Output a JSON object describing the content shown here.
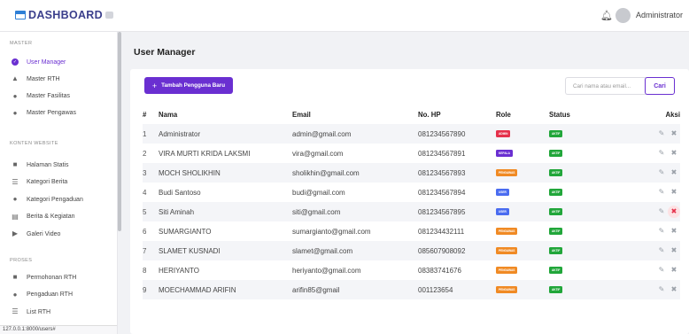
{
  "app": {
    "brand_prefix": "D",
    "brand": "DASHBOARD",
    "user": "Administrator"
  },
  "sidebar": {
    "sections": [
      {
        "label": "MASTER",
        "items": [
          {
            "label": "User Manager",
            "icon": "user-circle-icon",
            "active": true
          },
          {
            "label": "Master RTH",
            "icon": "bell-icon"
          },
          {
            "label": "Master Fasilitas",
            "icon": "pin-icon"
          },
          {
            "label": "Master Pengawas",
            "icon": "user-icon"
          }
        ]
      },
      {
        "label": "KONTEN WEBSITE",
        "items": [
          {
            "label": "Halaman Statis",
            "icon": "file-icon"
          },
          {
            "label": "Kategori Berita",
            "icon": "list-icon"
          },
          {
            "label": "Kategori Pengaduan",
            "icon": "users-icon"
          },
          {
            "label": "Berita & Kegiatan",
            "icon": "newspaper-icon"
          },
          {
            "label": "Galeri Video",
            "icon": "video-icon"
          }
        ]
      },
      {
        "label": "PROSES",
        "items": [
          {
            "label": "Permohonan RTH",
            "icon": "file-icon"
          },
          {
            "label": "Pengaduan RTH",
            "icon": "users-icon"
          },
          {
            "label": "List RTH",
            "icon": "list-icon"
          }
        ]
      }
    ]
  },
  "status_url": "127.0.0.1:8000/users#",
  "page": {
    "title": "User Manager"
  },
  "toolbar": {
    "add_label": "Tambah Pengguna Baru",
    "search_placeholder": "Cari nama atau email...",
    "search_button": "Cari"
  },
  "table": {
    "headers": [
      "#",
      "Nama",
      "Email",
      "No. HP",
      "Role",
      "Status",
      "Aksi"
    ],
    "rows": [
      {
        "no": "1",
        "nama": "Administrator",
        "email": "admin@gmail.com",
        "hp": "081234567890",
        "role": "ADMIN",
        "status": "AKTIF"
      },
      {
        "no": "2",
        "nama": "VIRA MURTI KRIDA LAKSMI",
        "email": "vira@gmail.com",
        "hp": "081234567891",
        "role": "KEPALA",
        "status": "AKTIF"
      },
      {
        "no": "3",
        "nama": "MOCH SHOLIKHIN",
        "email": "sholikhin@gmail.com",
        "hp": "081234567893",
        "role": "PENGAWAS",
        "status": "AKTIF"
      },
      {
        "no": "4",
        "nama": "Budi Santoso",
        "email": "budi@gmail.com",
        "hp": "081234567894",
        "role": "USER",
        "status": "AKTIF"
      },
      {
        "no": "5",
        "nama": "Siti Aminah",
        "email": "siti@gmail.com",
        "hp": "081234567895",
        "role": "USER",
        "status": "AKTIF"
      },
      {
        "no": "6",
        "nama": "SUMARGIANTO",
        "email": "sumargianto@gmail.com",
        "hp": "081234432111",
        "role": "PENGAWAS",
        "status": "AKTIF"
      },
      {
        "no": "7",
        "nama": "SLAMET KUSNADI",
        "email": "slamet@gmail.com",
        "hp": "085607908092",
        "role": "PENGAWAS",
        "status": "AKTIF"
      },
      {
        "no": "8",
        "nama": "HERIYANTO",
        "email": "heriyanto@gmail.com",
        "hp": "08383741676",
        "role": "PENGAWAS",
        "status": "AKTIF"
      },
      {
        "no": "9",
        "nama": "MOECHAMMAD ARIFIN",
        "email": "arifin85@gmail",
        "hp": "001123654",
        "role": "PENGAWAS",
        "status": "AKTIF"
      }
    ]
  },
  "colors": {
    "accent": "#6a2fd1",
    "role_admin": "#e5314b",
    "role_kepala": "#6a2fd1",
    "role_pengawas": "#f08a24",
    "role_user": "#4a6cf0",
    "status_aktif": "#21a63a"
  }
}
